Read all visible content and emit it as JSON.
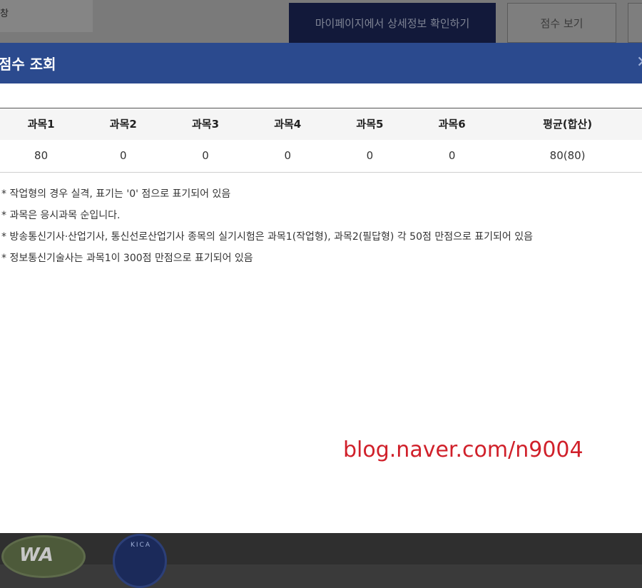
{
  "background": {
    "field_text": "창",
    "mypage_button": "마이페이지에서 상세정보 확인하기",
    "score_button": "점수 보기"
  },
  "modal": {
    "title": "점수 조회",
    "close_icon": "close-icon",
    "table": {
      "headers": [
        "과목1",
        "과목2",
        "과목3",
        "과목4",
        "과목5",
        "과목6",
        "평균(합산)"
      ],
      "row": [
        "80",
        "0",
        "0",
        "0",
        "0",
        "0",
        "80(80)"
      ]
    },
    "notes": [
      "* 작업형의 경우 실격, 표기는 '0' 점으로 표기되어 있음",
      "* 과목은 응시과목 순입니다.",
      "* 방송통신기사·산업기사, 통신선로산업기사 종목의 실기시험은 과목1(작업형), 과목2(필답형) 각 50점 만점으로 표기되어 있음",
      "* 정보통신기술사는 과목1이 300점 만점으로 표기되어 있음"
    ],
    "watermark": "blog.naver.com/n9004"
  },
  "footer": {
    "logo_left": "WA",
    "logo_right": "KICA"
  },
  "colors": {
    "modal_header": "#2b4a8e",
    "watermark": "#d0202a"
  }
}
